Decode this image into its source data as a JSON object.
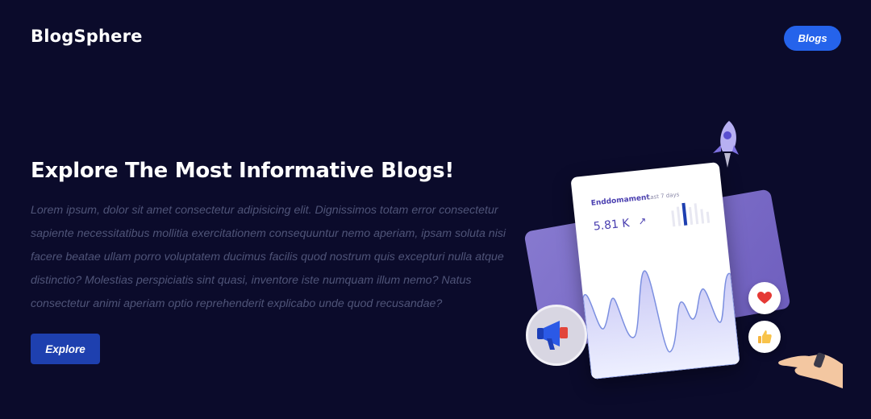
{
  "header": {
    "logo": "BlogSphere",
    "nav_button": "Blogs"
  },
  "hero": {
    "title": "Explore The Most Informative Blogs!",
    "description": "Lorem ipsum, dolor sit amet consectetur adipisicing elit. Dignissimos totam error consectetur sapiente necessitatibus mollitia exercitationem consequuntur nemo aperiam, ipsam soluta nisi facere beatae ullam porro voluptatem ducimus facilis quod nostrum quis excepturi nulla atque distinctio? Molestias perspiciatis sint quasi, inventore iste numquam illum nemo? Natus consectetur animi aperiam optio reprehenderit explicabo unde quod recusandae?",
    "button": "Explore"
  },
  "illustration": {
    "card_title": "Enddomament",
    "card_subtitle": "Last 7 days",
    "card_value": "5.81 K",
    "card_arrow": "↗",
    "icons": [
      "rocket-icon",
      "megaphone-icon",
      "heart-icon",
      "thumbs-up-icon",
      "hand-icon"
    ]
  },
  "colors": {
    "background": "#0b0b2b",
    "accent": "#2563eb",
    "explore_button": "#1e40af",
    "panel_purple": "#8d7fd8"
  }
}
